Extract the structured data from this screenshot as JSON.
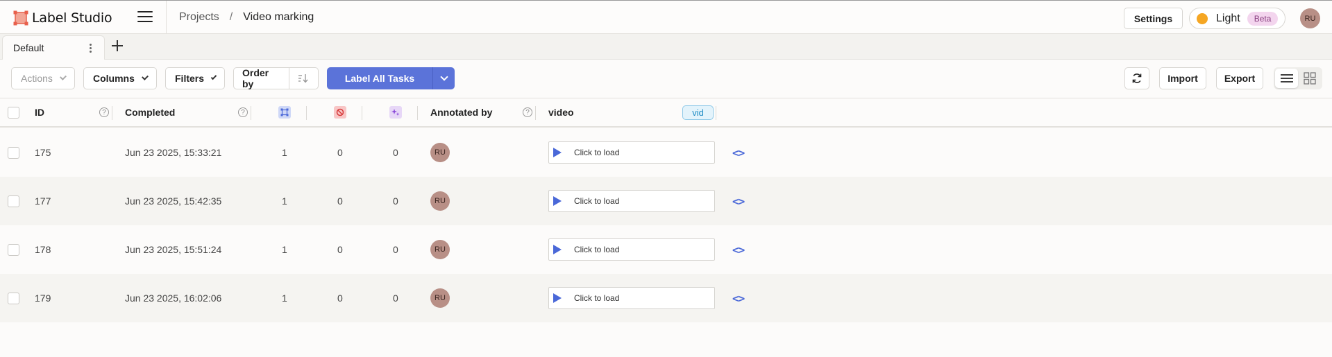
{
  "app": {
    "name": "Label Studio",
    "brand_color": "#e8604c"
  },
  "topbar": {
    "breadcrumb": {
      "projects": "Projects",
      "separator": "/",
      "current": "Video marking"
    },
    "settings_label": "Settings",
    "theme": {
      "label": "Light",
      "badge": "Beta"
    },
    "user_initials": "RU"
  },
  "tabs": [
    {
      "label": "Default"
    }
  ],
  "toolbar": {
    "actions_label": "Actions",
    "columns_label": "Columns",
    "filters_label": "Filters",
    "order_by_label": "Order by",
    "label_all_label": "Label All Tasks",
    "import_label": "Import",
    "export_label": "Export",
    "accent_color": "#5b73d9"
  },
  "table": {
    "headers": {
      "id": "ID",
      "completed": "Completed",
      "annotated_by": "Annotated by",
      "video": "video",
      "video_tag": "vid"
    },
    "rows": [
      {
        "id": "175",
        "completed": "Jun 23 2025, 15:33:21",
        "annotations": "1",
        "skipped": "0",
        "predictions": "0",
        "annotator": "RU",
        "video_action": "Click to load"
      },
      {
        "id": "177",
        "completed": "Jun 23 2025, 15:42:35",
        "annotations": "1",
        "skipped": "0",
        "predictions": "0",
        "annotator": "RU",
        "video_action": "Click to load"
      },
      {
        "id": "178",
        "completed": "Jun 23 2025, 15:51:24",
        "annotations": "1",
        "skipped": "0",
        "predictions": "0",
        "annotator": "RU",
        "video_action": "Click to load"
      },
      {
        "id": "179",
        "completed": "Jun 23 2025, 16:02:06",
        "annotations": "1",
        "skipped": "0",
        "predictions": "0",
        "annotator": "RU",
        "video_action": "Click to load"
      }
    ]
  }
}
